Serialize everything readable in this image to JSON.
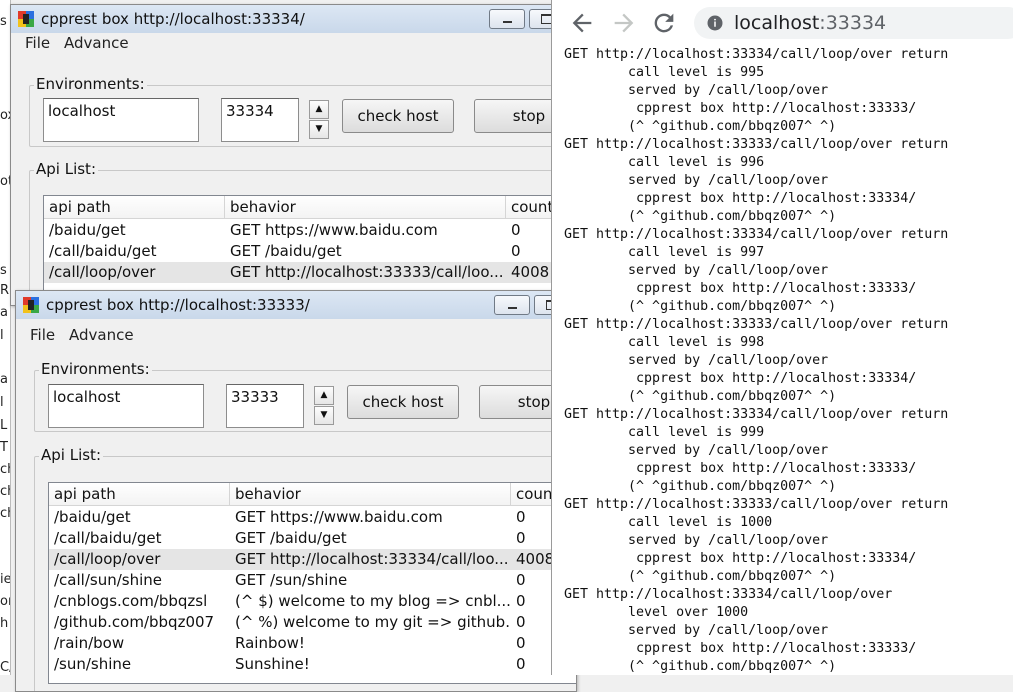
{
  "background_fragments": [
    "s",
    "ox",
    "ot",
    "s",
    "R",
    "a",
    "l",
    "a",
    "l",
    "L",
    "T",
    "ch",
    "ch.",
    "ch",
    "ie",
    "om",
    "h",
    "C/"
  ],
  "window_back": {
    "title": "cpprest box http://localhost:33334/",
    "menu": [
      "File",
      "Advance"
    ],
    "env_label": "Environments:",
    "host_value": "localhost",
    "port_value": "33334",
    "check_host_label": "check host",
    "stop_label": "stop",
    "api_label": "Api List:",
    "columns": [
      "api path",
      "behavior",
      "count"
    ],
    "rows": [
      {
        "path": "/baidu/get",
        "behavior": "GET https://www.baidu.com",
        "count": "0"
      },
      {
        "path": "/call/baidu/get",
        "behavior": "GET /baidu/get",
        "count": "0"
      },
      {
        "path": "/call/loop/over",
        "behavior": "GET http://localhost:33333/call/loo...",
        "count": "4008"
      }
    ]
  },
  "window_front": {
    "title": "cpprest box http://localhost:33333/",
    "menu": [
      "File",
      "Advance"
    ],
    "env_label": "Environments:",
    "host_value": "localhost",
    "port_value": "33333",
    "check_host_label": "check host",
    "stop_label": "stop",
    "api_label": "Api List:",
    "columns": [
      "api path",
      "behavior",
      "count"
    ],
    "rows": [
      {
        "path": "/baidu/get",
        "behavior": "GET https://www.baidu.com",
        "count": "0"
      },
      {
        "path": "/call/baidu/get",
        "behavior": "GET /baidu/get",
        "count": "0"
      },
      {
        "path": "/call/loop/over",
        "behavior": "GET http://localhost:33334/call/loo...",
        "count": "4008"
      },
      {
        "path": "/call/sun/shine",
        "behavior": "GET /sun/shine",
        "count": "0"
      },
      {
        "path": "/cnblogs.com/bbqzsl",
        "behavior": "(^ $) welcome to my blog => cnbl...",
        "count": "0"
      },
      {
        "path": "/github.com/bbqz007",
        "behavior": "(^ %) welcome to my git => github...",
        "count": "0"
      },
      {
        "path": "/rain/bow",
        "behavior": "Rainbow!",
        "count": "0"
      },
      {
        "path": "/sun/shine",
        "behavior": "Sunshine!",
        "count": "0"
      }
    ]
  },
  "browser": {
    "url_host": "localhost",
    "url_port": ":33334",
    "icons": [
      "back-arrow-icon",
      "forward-arrow-icon",
      "reload-icon",
      "site-info-icon"
    ],
    "lines": [
      "GET http://localhost:33334/call/loop/over return",
      "        call level is 995",
      "        served by /call/loop/over",
      "         cpprest box http://localhost:33333/",
      "        (^ ^github.com/bbqz007^ ^)",
      "GET http://localhost:33333/call/loop/over return",
      "        call level is 996",
      "        served by /call/loop/over",
      "         cpprest box http://localhost:33334/",
      "        (^ ^github.com/bbqz007^ ^)",
      "GET http://localhost:33334/call/loop/over return",
      "        call level is 997",
      "        served by /call/loop/over",
      "         cpprest box http://localhost:33333/",
      "        (^ ^github.com/bbqz007^ ^)",
      "GET http://localhost:33333/call/loop/over return",
      "        call level is 998",
      "        served by /call/loop/over",
      "         cpprest box http://localhost:33334/",
      "        (^ ^github.com/bbqz007^ ^)",
      "GET http://localhost:33334/call/loop/over return",
      "        call level is 999",
      "        served by /call/loop/over",
      "         cpprest box http://localhost:33333/",
      "        (^ ^github.com/bbqz007^ ^)",
      "GET http://localhost:33333/call/loop/over return",
      "        call level is 1000",
      "        served by /call/loop/over",
      "         cpprest box http://localhost:33334/",
      "        (^ ^github.com/bbqz007^ ^)",
      "GET http://localhost:33334/call/loop/over",
      "        level over 1000",
      "        served by /call/loop/over",
      "         cpprest box http://localhost:33333/",
      "        (^ ^github.com/bbqz007^ ^)"
    ]
  }
}
